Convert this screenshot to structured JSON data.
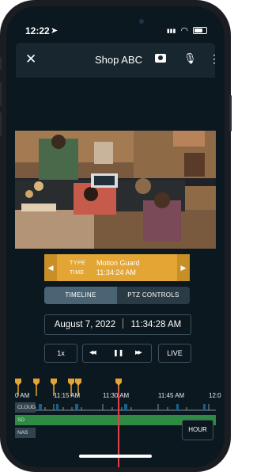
{
  "status_bar": {
    "time": "12:22",
    "location_glyph": "➤",
    "signal_glyph": "▮▮▮",
    "wifi_glyph": "◠"
  },
  "header": {
    "close_glyph": "✕",
    "title": "Shop ABC",
    "mic_glyph": "🎙",
    "more_glyph": "⋮"
  },
  "event": {
    "prev_glyph": "◀",
    "next_glyph": "▶",
    "type_label": "TYPE",
    "type_value": "Motion Guard",
    "time_label": "TIME",
    "time_value": "11:34:24 AM"
  },
  "tabs": [
    {
      "label": "TIMELINE",
      "active": true
    },
    {
      "label": "PTZ CONTROLS",
      "active": false
    }
  ],
  "playback": {
    "date": "August 7, 2022",
    "time": "11:34:28 AM",
    "speed_label": "1x",
    "rewind_glyph": "◀◀",
    "pause_glyph": "❚❚",
    "forward_glyph": "▶▶",
    "live_label": "LIVE"
  },
  "timeline": {
    "tick_labels": [
      "0 AM",
      "11:15 AM",
      "11:30 AM",
      "11:45 AM",
      "12:0"
    ],
    "rows": [
      {
        "label": "CLOUD"
      },
      {
        "label": "SD"
      },
      {
        "label": "NAS"
      }
    ],
    "zoom_label": "HOUR",
    "marker_color": "#e3a634",
    "playhead_color": "#e0444a",
    "sd_color": "#2f8a44",
    "cloud_color": "#1d5f86"
  }
}
